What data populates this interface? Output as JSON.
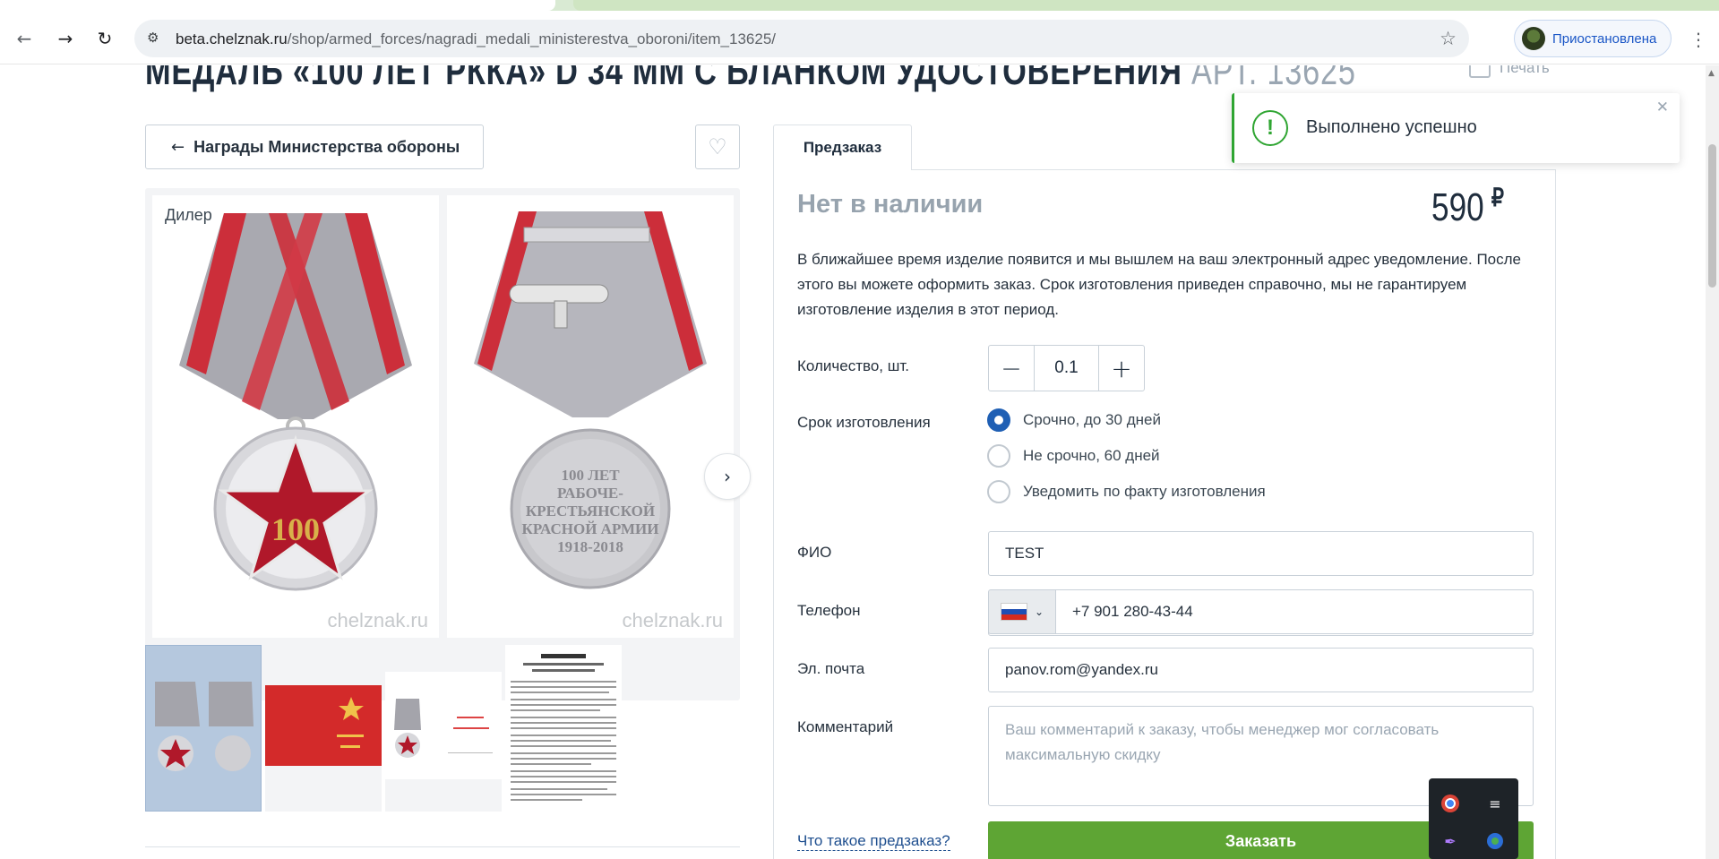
{
  "browser": {
    "url_host": "beta.chelznak.ru",
    "url_path": "/shop/armed_forces/nagradi_medali_ministerestva_oboroni/item_13625/",
    "profile_label": "Приостановлена"
  },
  "product": {
    "title": "МЕДАЛЬ «100 ЛЕТ РККА» D 34 ММ С БЛАНКОМ УДОСТОВЕРЕНИЯ",
    "article": "АРТ. 13625",
    "print_label": "Печать",
    "back_label": "Награды Министерства обороны",
    "dealer_label": "Дилер",
    "watermark": "chelznak.ru",
    "medal_text": "100",
    "reverse_lines": [
      "100 ЛЕТ",
      "РАБОЧЕ-",
      "КРЕСТЬЯНСКОЙ",
      "КРАСНОЙ АРМИИ",
      "1918-2018"
    ]
  },
  "order": {
    "tab_label": "Предзаказ",
    "stock_status": "Нет в наличии",
    "price": "590",
    "currency": "₽",
    "note": "В ближайшее время изделие появится и мы вышлем на ваш электронный адрес уведомление. После этого вы можете оформить заказ. Срок изготовления приведен справочно, мы не гарантируем изготовление изделия в этот период.",
    "quantity_label": "Количество, шт.",
    "quantity_value": "0.1",
    "term_label": "Срок изготовления",
    "term_options": [
      "Срочно, до 30 дней",
      "Не срочно, 60 дней",
      "Уведомить по факту изготовления"
    ],
    "name_label": "ФИО",
    "name_value": "TEST",
    "phone_label": "Телефон",
    "phone_value": "+7 901 280-43-44",
    "email_label": "Эл. почта",
    "email_value": "panov.rom@yandex.ru",
    "comment_label": "Комментарий",
    "comment_placeholder": "Ваш комментарий к заказу, чтобы менеджер мог согласовать максимальную скидку",
    "what_is_preorder": "Что такое предзаказ?",
    "submit_label": "Заказать"
  },
  "toast": {
    "message": "Выполнено успешно"
  },
  "colors": {
    "accent_green": "#5ea534",
    "radio_blue": "#1f5fb4",
    "success_green": "#2fa532"
  }
}
